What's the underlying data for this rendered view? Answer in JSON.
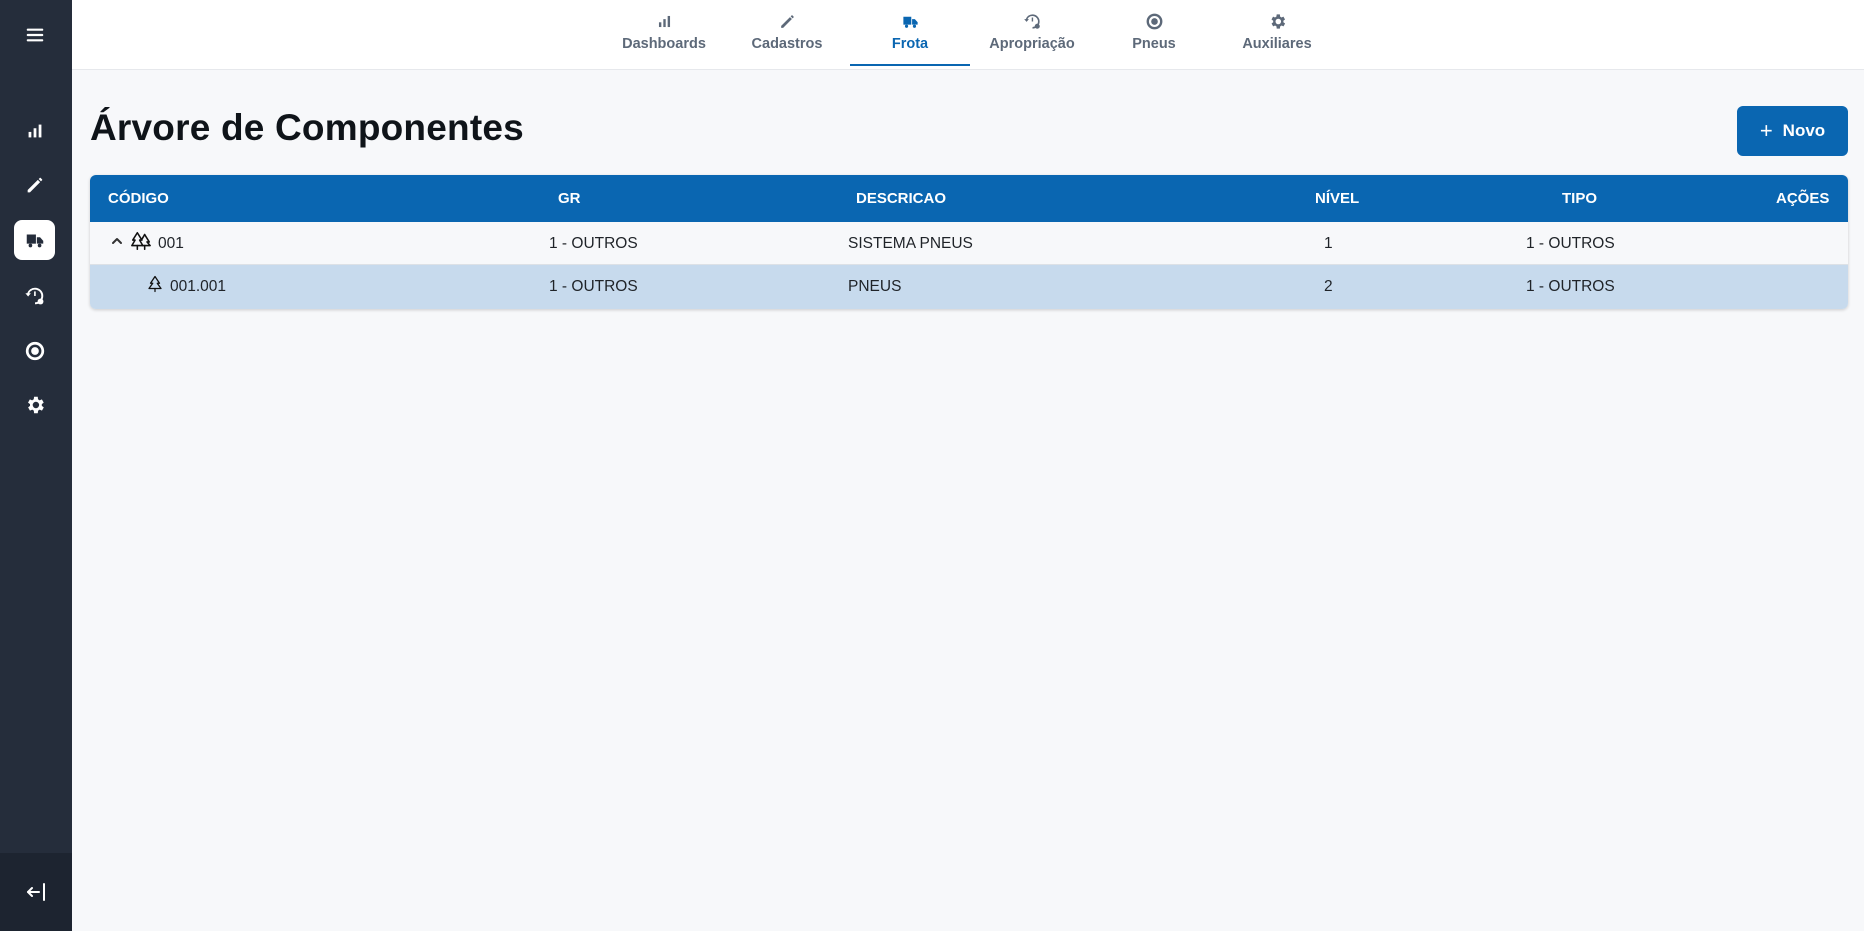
{
  "nav": {
    "tabs": [
      {
        "label": "Dashboards",
        "icon": "bar-chart-icon"
      },
      {
        "label": "Cadastros",
        "icon": "pencil-icon"
      },
      {
        "label": "Frota",
        "icon": "truck-icon",
        "active": true
      },
      {
        "label": "Apropriação",
        "icon": "history-gear-icon"
      },
      {
        "label": "Pneus",
        "icon": "tire-icon"
      },
      {
        "label": "Auxiliares",
        "icon": "gear-icon"
      }
    ]
  },
  "sidebar": {
    "items": [
      "menu-icon",
      "bar-chart-icon",
      "pencil-icon",
      "truck-icon",
      "history-gear-icon",
      "tire-icon",
      "gear-icon"
    ],
    "active": "truck-icon",
    "logout_icon": "logout-icon"
  },
  "page": {
    "title": "Árvore de Componentes",
    "new_button": "Novo",
    "new_button_icon": "+"
  },
  "table": {
    "headers": {
      "codigo": "CÓDIGO",
      "gr": "GR",
      "descricao": "DESCRICAO",
      "nivel": "NÍVEL",
      "tipo": "TIPO",
      "acoes": "AÇÕES"
    },
    "rows": [
      {
        "codigo": "001",
        "gr": "1 - OUTROS",
        "descricao": "SISTEMA PNEUS",
        "nivel": "1",
        "tipo": "1 - OUTROS",
        "expanded": true
      },
      {
        "codigo": "001.001",
        "gr": "1 - OUTROS",
        "descricao": "PNEUS",
        "nivel": "2",
        "tipo": "1 - OUTROS",
        "selected": true
      }
    ]
  },
  "colors": {
    "primary": "#0a66b1",
    "sidebar": "#252d3b",
    "selected_row": "#c7daed"
  }
}
